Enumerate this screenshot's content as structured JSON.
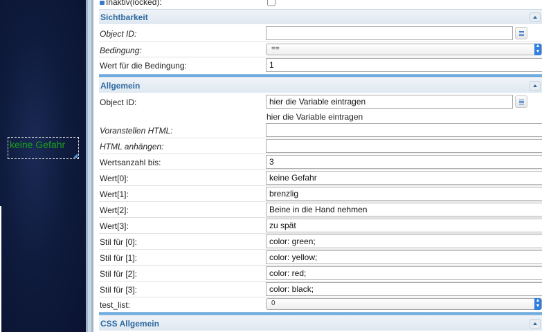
{
  "canvas": {
    "widget_text": "keine Gefahr"
  },
  "panel": {
    "top_row": {
      "label": "Inaktiv(locked):"
    },
    "sichtbarkeit": {
      "title": "Sichtbarkeit",
      "object_id_label": "Object ID:",
      "object_id_value": "",
      "condition_label": "Bedingung:",
      "condition_value": "==",
      "condition_value_label": "Wert für die Bedingung:",
      "condition_value_value": "1"
    },
    "allgemein": {
      "title": "Allgemein",
      "object_id_label": "Object ID:",
      "object_id_value": "hier die Variable eintragen",
      "object_id_hint": "hier die Variable eintragen",
      "prepend_label": "Voranstellen HTML:",
      "prepend_value": "",
      "append_label": "HTML anhängen:",
      "append_value": "",
      "count_label": "Wertsanzahl bis:",
      "count_value": "3",
      "values": [
        {
          "label": "Wert[0]:",
          "value": "keine Gefahr"
        },
        {
          "label": "Wert[1]:",
          "value": "brenzlig"
        },
        {
          "label": "Wert[2]:",
          "value": "Beine in die Hand nehmen"
        },
        {
          "label": "Wert[3]:",
          "value": "zu spät"
        }
      ],
      "styles": [
        {
          "label": "Stil für [0]:",
          "value": "color: green;"
        },
        {
          "label": "Stil für [1]:",
          "value": "color: yellow;"
        },
        {
          "label": "Stil für [2]:",
          "value": "color: red;"
        },
        {
          "label": "Stil für [3]:",
          "value": "color: black;"
        }
      ],
      "test_list_label": "test_list:",
      "test_list_value": "0"
    },
    "css_allgemein": {
      "title": "CSS Allgemein"
    }
  },
  "colors": {
    "accent": "#2f6aa0",
    "select_arrow": "#2f7fe0",
    "widget_text": "#1aa01a",
    "canvas_bg": "#0f1b3d"
  }
}
